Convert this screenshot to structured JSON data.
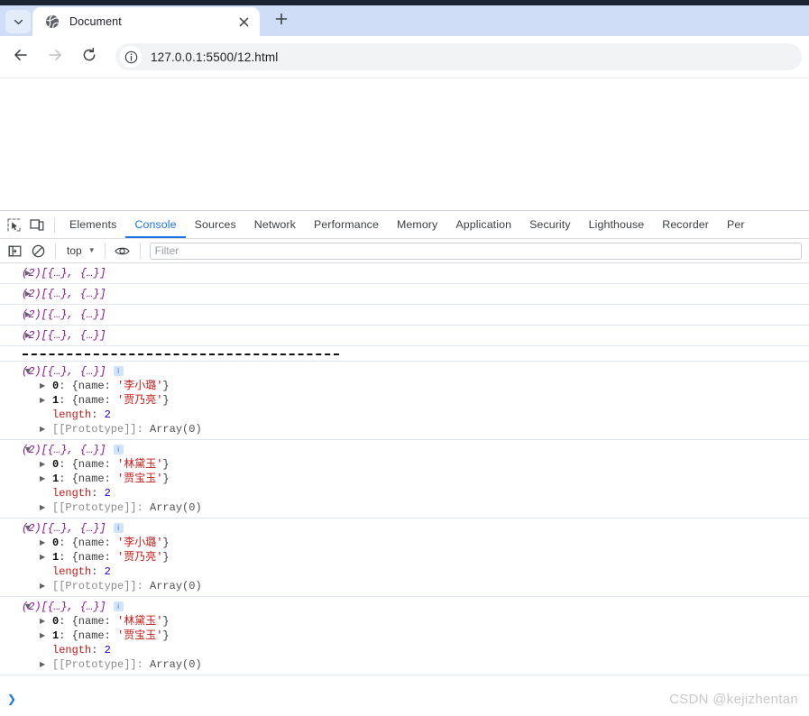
{
  "browser": {
    "tab": {
      "title": "Document",
      "favicon_icon": "globe-icon",
      "close_icon": "close-icon",
      "tablist_icon": "chevron-down-icon"
    },
    "new_tab_label": "+",
    "nav": {
      "back_icon": "arrow-left-icon",
      "forward_icon": "arrow-right-icon",
      "reload_icon": "reload-icon"
    },
    "omnibox": {
      "site_info_icon": "info-circle-icon",
      "url": "127.0.0.1:5500/12.html"
    }
  },
  "devtools": {
    "left_tools": [
      {
        "name": "inspect-element-icon",
        "title": "Inspect"
      },
      {
        "name": "device-toolbar-icon",
        "title": "Toggle device toolbar"
      }
    ],
    "panels": [
      {
        "label": "Elements",
        "active": false
      },
      {
        "label": "Console",
        "active": true
      },
      {
        "label": "Sources",
        "active": false
      },
      {
        "label": "Network",
        "active": false
      },
      {
        "label": "Performance",
        "active": false
      },
      {
        "label": "Memory",
        "active": false
      },
      {
        "label": "Application",
        "active": false
      },
      {
        "label": "Security",
        "active": false
      },
      {
        "label": "Lighthouse",
        "active": false
      },
      {
        "label": "Recorder",
        "active": false
      },
      {
        "label": "Per",
        "active": false
      }
    ],
    "filterbar": {
      "sidebar_icon": "show-console-sidebar-icon",
      "clear_icon": "clear-console-icon",
      "context": "top",
      "context_caret": "▼",
      "eye_icon": "eye-icon",
      "filter_placeholder": "Filter",
      "filter_value": ""
    },
    "console": {
      "collapsed_rows": [
        {
          "count": "(2)",
          "preview": "[{…}, {…}]",
          "arrow": "▶"
        },
        {
          "count": "(2)",
          "preview": "[{…}, {…}]",
          "arrow": "▶"
        },
        {
          "count": "(2)",
          "preview": "[{…}, {…}]",
          "arrow": "▶"
        },
        {
          "count": "(2)",
          "preview": "[{…}, {…}]",
          "arrow": "▶"
        }
      ],
      "separator": "----------------------------------------------",
      "expanded_rows": [
        {
          "arrow": "▼",
          "count": "(2)",
          "preview": "[{…}, {…}]",
          "badge": "i",
          "items": [
            {
              "arrow": "▶",
              "index": "0",
              "text": ": {name: ",
              "value": "'李小璐'",
              "close": "}"
            },
            {
              "arrow": "▶",
              "index": "1",
              "text": ": {name: ",
              "value": "'贾乃亮'",
              "close": "}"
            }
          ],
          "length_key": "length",
          "length_value": "2",
          "proto_key": "[[Prototype]]",
          "proto_value": "Array(0)",
          "proto_arrow": "▶"
        },
        {
          "arrow": "▼",
          "count": "(2)",
          "preview": "[{…}, {…}]",
          "badge": "i",
          "items": [
            {
              "arrow": "▶",
              "index": "0",
              "text": ": {name: ",
              "value": "'林黛玉'",
              "close": "}"
            },
            {
              "arrow": "▶",
              "index": "1",
              "text": ": {name: ",
              "value": "'贾宝玉'",
              "close": "}"
            }
          ],
          "length_key": "length",
          "length_value": "2",
          "proto_key": "[[Prototype]]",
          "proto_value": "Array(0)",
          "proto_arrow": "▶"
        },
        {
          "arrow": "▼",
          "count": "(2)",
          "preview": "[{…}, {…}]",
          "badge": "i",
          "items": [
            {
              "arrow": "▶",
              "index": "0",
              "text": ": {name: ",
              "value": "'李小璐'",
              "close": "}"
            },
            {
              "arrow": "▶",
              "index": "1",
              "text": ": {name: ",
              "value": "'贾乃亮'",
              "close": "}"
            }
          ],
          "length_key": "length",
          "length_value": "2",
          "proto_key": "[[Prototype]]",
          "proto_value": "Array(0)",
          "proto_arrow": "▶"
        },
        {
          "arrow": "▼",
          "count": "(2)",
          "preview": "[{…}, {…}]",
          "badge": "i",
          "items": [
            {
              "arrow": "▶",
              "index": "0",
              "text": ": {name: ",
              "value": "'林黛玉'",
              "close": "}"
            },
            {
              "arrow": "▶",
              "index": "1",
              "text": ": {name: ",
              "value": "'贾宝玉'",
              "close": "}"
            }
          ],
          "length_key": "length",
          "length_value": "2",
          "proto_key": "[[Prototype]]",
          "proto_value": "Array(0)",
          "proto_arrow": "▶"
        }
      ],
      "prompt_caret": "❯"
    }
  },
  "watermark": "CSDN @kejizhentan",
  "colors": {
    "accent": "#1a73e8",
    "tabstrip": "#cfdef6",
    "string": "#c41a16",
    "number": "#1c00cf",
    "keyword": "#881391"
  }
}
